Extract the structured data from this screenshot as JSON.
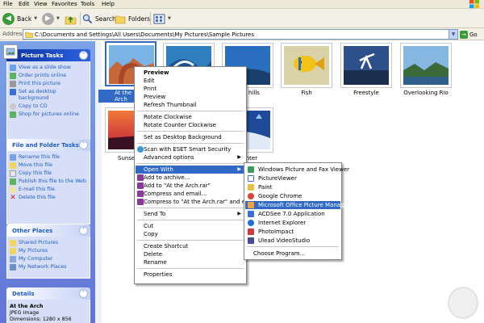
{
  "menubar": {
    "items": [
      "File",
      "Edit",
      "View",
      "Favorites",
      "Tools",
      "Help"
    ]
  },
  "toolbar": {
    "back": "Back",
    "search": "Search",
    "folders": "Folders"
  },
  "address": {
    "label": "Address",
    "value": "C:\\Documents and Settings\\All Users\\Documents\\My Pictures\\Sample Pictures",
    "go": "Go"
  },
  "sidebar": {
    "picture_tasks": {
      "title": "Picture Tasks",
      "items": [
        "View as a slide show",
        "Order prints online",
        "Print this picture",
        "Set as desktop background",
        "Copy to CD",
        "Shop for pictures online"
      ]
    },
    "file_tasks": {
      "title": "File and Folder Tasks",
      "items": [
        "Rename this file",
        "Move this file",
        "Copy this file",
        "Publish this file to the Web",
        "E-mail this file",
        "Delete this file"
      ]
    },
    "other_places": {
      "title": "Other Places",
      "items": [
        "Shared Pictures",
        "My Pictures",
        "My Computer",
        "My Network Places"
      ]
    },
    "details": {
      "title": "Details",
      "name": "At the Arch",
      "type": "JPEG Image",
      "dims": "Dimensions: 1280 x 856"
    }
  },
  "files": [
    {
      "label": "At the Arch"
    },
    {
      "label": ""
    },
    {
      "label": "hills"
    },
    {
      "label": "Fish"
    },
    {
      "label": "Freestyle"
    },
    {
      "label": "Overlooking Rio"
    },
    {
      "label": "Sunset"
    },
    {
      "label": "Winter"
    }
  ],
  "context_menu": {
    "items": [
      {
        "label": "Preview",
        "bold": true
      },
      {
        "label": "Edit"
      },
      {
        "label": "Print"
      },
      {
        "label": "Preview"
      },
      {
        "label": "Refresh Thumbnail"
      },
      {
        "label": "Rotate Clockwise"
      },
      {
        "label": "Rotate Counter Clockwise"
      },
      {
        "label": "Set as Desktop Background"
      },
      {
        "label": "Scan with ESET Smart Security"
      },
      {
        "label": "Advanced options"
      },
      {
        "label": "Open With"
      },
      {
        "label": "Add to archive..."
      },
      {
        "label": "Add to \"At the Arch.rar\""
      },
      {
        "label": "Compress and email..."
      },
      {
        "label": "Compress to \"At the Arch.rar\" and email"
      },
      {
        "label": "Send To"
      },
      {
        "label": "Cut"
      },
      {
        "label": "Copy"
      },
      {
        "label": "Create Shortcut"
      },
      {
        "label": "Delete"
      },
      {
        "label": "Rename"
      },
      {
        "label": "Properties"
      }
    ]
  },
  "open_with_menu": {
    "items": [
      {
        "label": "Windows Picture and Fax Viewer"
      },
      {
        "label": "PictureViewer"
      },
      {
        "label": "Paint"
      },
      {
        "label": "Google Chrome"
      },
      {
        "label": "Microsoft Office Picture Manager"
      },
      {
        "label": "ACDSee 7.0 Application"
      },
      {
        "label": "Internet Explorer"
      },
      {
        "label": "PhotoImpact"
      },
      {
        "label": "Ulead VideoStudio"
      },
      {
        "label": "Choose Program..."
      }
    ]
  }
}
